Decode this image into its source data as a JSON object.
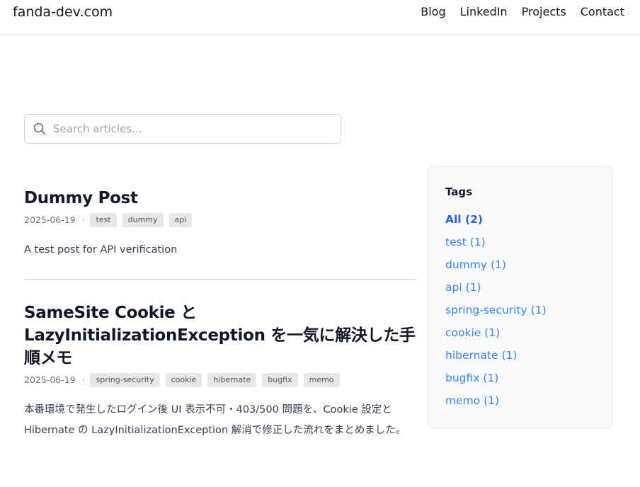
{
  "header": {
    "brand": "fanda-dev.com",
    "nav": [
      "Blog",
      "LinkedIn",
      "Projects",
      "Contact"
    ]
  },
  "search": {
    "placeholder": "Search articles...",
    "value": ""
  },
  "posts": [
    {
      "title": "Dummy Post",
      "date": "2025-06-19",
      "separator": "·",
      "tags": [
        "test",
        "dummy",
        "api"
      ],
      "excerpt": "A test post for API verification"
    },
    {
      "title": "SameSite Cookie と LazyInitializationException を一気に解決した手順メモ",
      "date": "2025-06-19",
      "separator": "·",
      "tags": [
        "spring-security",
        "cookie",
        "hibernate",
        "bugfix",
        "memo"
      ],
      "excerpt": "本番環境で発生したログイン後 UI 表示不可・403/500 問題を、Cookie 設定と Hibernate の LazyInitializationException 解消で修正した流れをまとめました。"
    }
  ],
  "sidebar": {
    "title": "Tags",
    "items": [
      {
        "label": "All (2)",
        "active": true
      },
      {
        "label": "test (1)"
      },
      {
        "label": "dummy (1)"
      },
      {
        "label": "api (1)"
      },
      {
        "label": "spring-security (1)"
      },
      {
        "label": "cookie (1)"
      },
      {
        "label": "hibernate (1)"
      },
      {
        "label": "bugfix (1)"
      },
      {
        "label": "memo (1)"
      }
    ]
  },
  "colors": {
    "link": "#3b82f6",
    "active_link": "#2563eb",
    "tag_bg": "#e5e7eb",
    "divider": "#d1d5db"
  },
  "icons": {
    "search": "search-icon"
  }
}
